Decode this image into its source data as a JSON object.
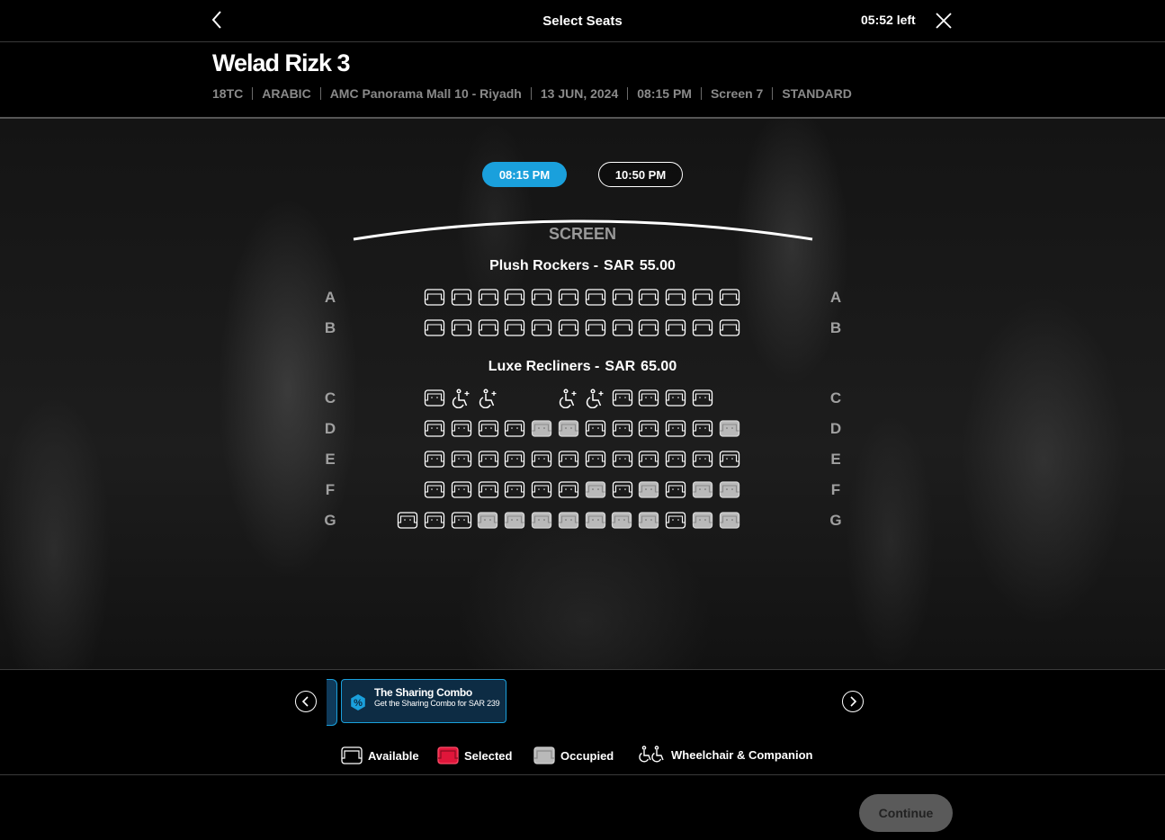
{
  "header": {
    "title": "Select Seats",
    "timer": "05:52 left"
  },
  "movie": {
    "title": "Welad Rizk 3",
    "meta": [
      "18TC",
      "ARABIC",
      "AMC Panorama Mall 10 - Riyadh",
      "13 JUN, 2024",
      "08:15 PM",
      "Screen 7",
      "STANDARD"
    ]
  },
  "showtimes": [
    {
      "label": "08:15 PM",
      "selected": true
    },
    {
      "label": "10:50 PM",
      "selected": false
    }
  ],
  "screen_label": "SCREEN",
  "sections": [
    {
      "name": "Plush Rockers -",
      "currency": "SAR",
      "price": "55.00"
    },
    {
      "name": "Luxe Recliners -",
      "currency": "SAR",
      "price": "65.00"
    }
  ],
  "rows": [
    {
      "label": "A",
      "seats": "AAAAAAAAAAAA"
    },
    {
      "label": "B",
      "seats": "AAAAAAAAAAAA"
    },
    {
      "label": "C",
      "seats": "Rww__wwRRRR"
    },
    {
      "label": "D",
      "seats": "RRRROORRRRRO"
    },
    {
      "label": "E",
      "seats": "RRRRRRRRRRRR"
    },
    {
      "label": "F",
      "seats": "RRRRRROROROO"
    },
    {
      "label": "G",
      "seats": "RRROOOOOOOROO"
    }
  ],
  "offer": {
    "title": "The Sharing Combo",
    "description": "Get the Sharing Combo for SAR 239",
    "badge_icon": "percent-badge-icon",
    "accent": "#1aa0dc"
  },
  "legend": {
    "available": "Available",
    "selected": "Selected",
    "occupied": "Occupied",
    "wheelchair": "Wheelchair & Companion"
  },
  "colors": {
    "accent": "#1aa0dc",
    "selected": "#e0163a",
    "occupied": "#b9b9b9"
  },
  "continue_label": "Continue"
}
